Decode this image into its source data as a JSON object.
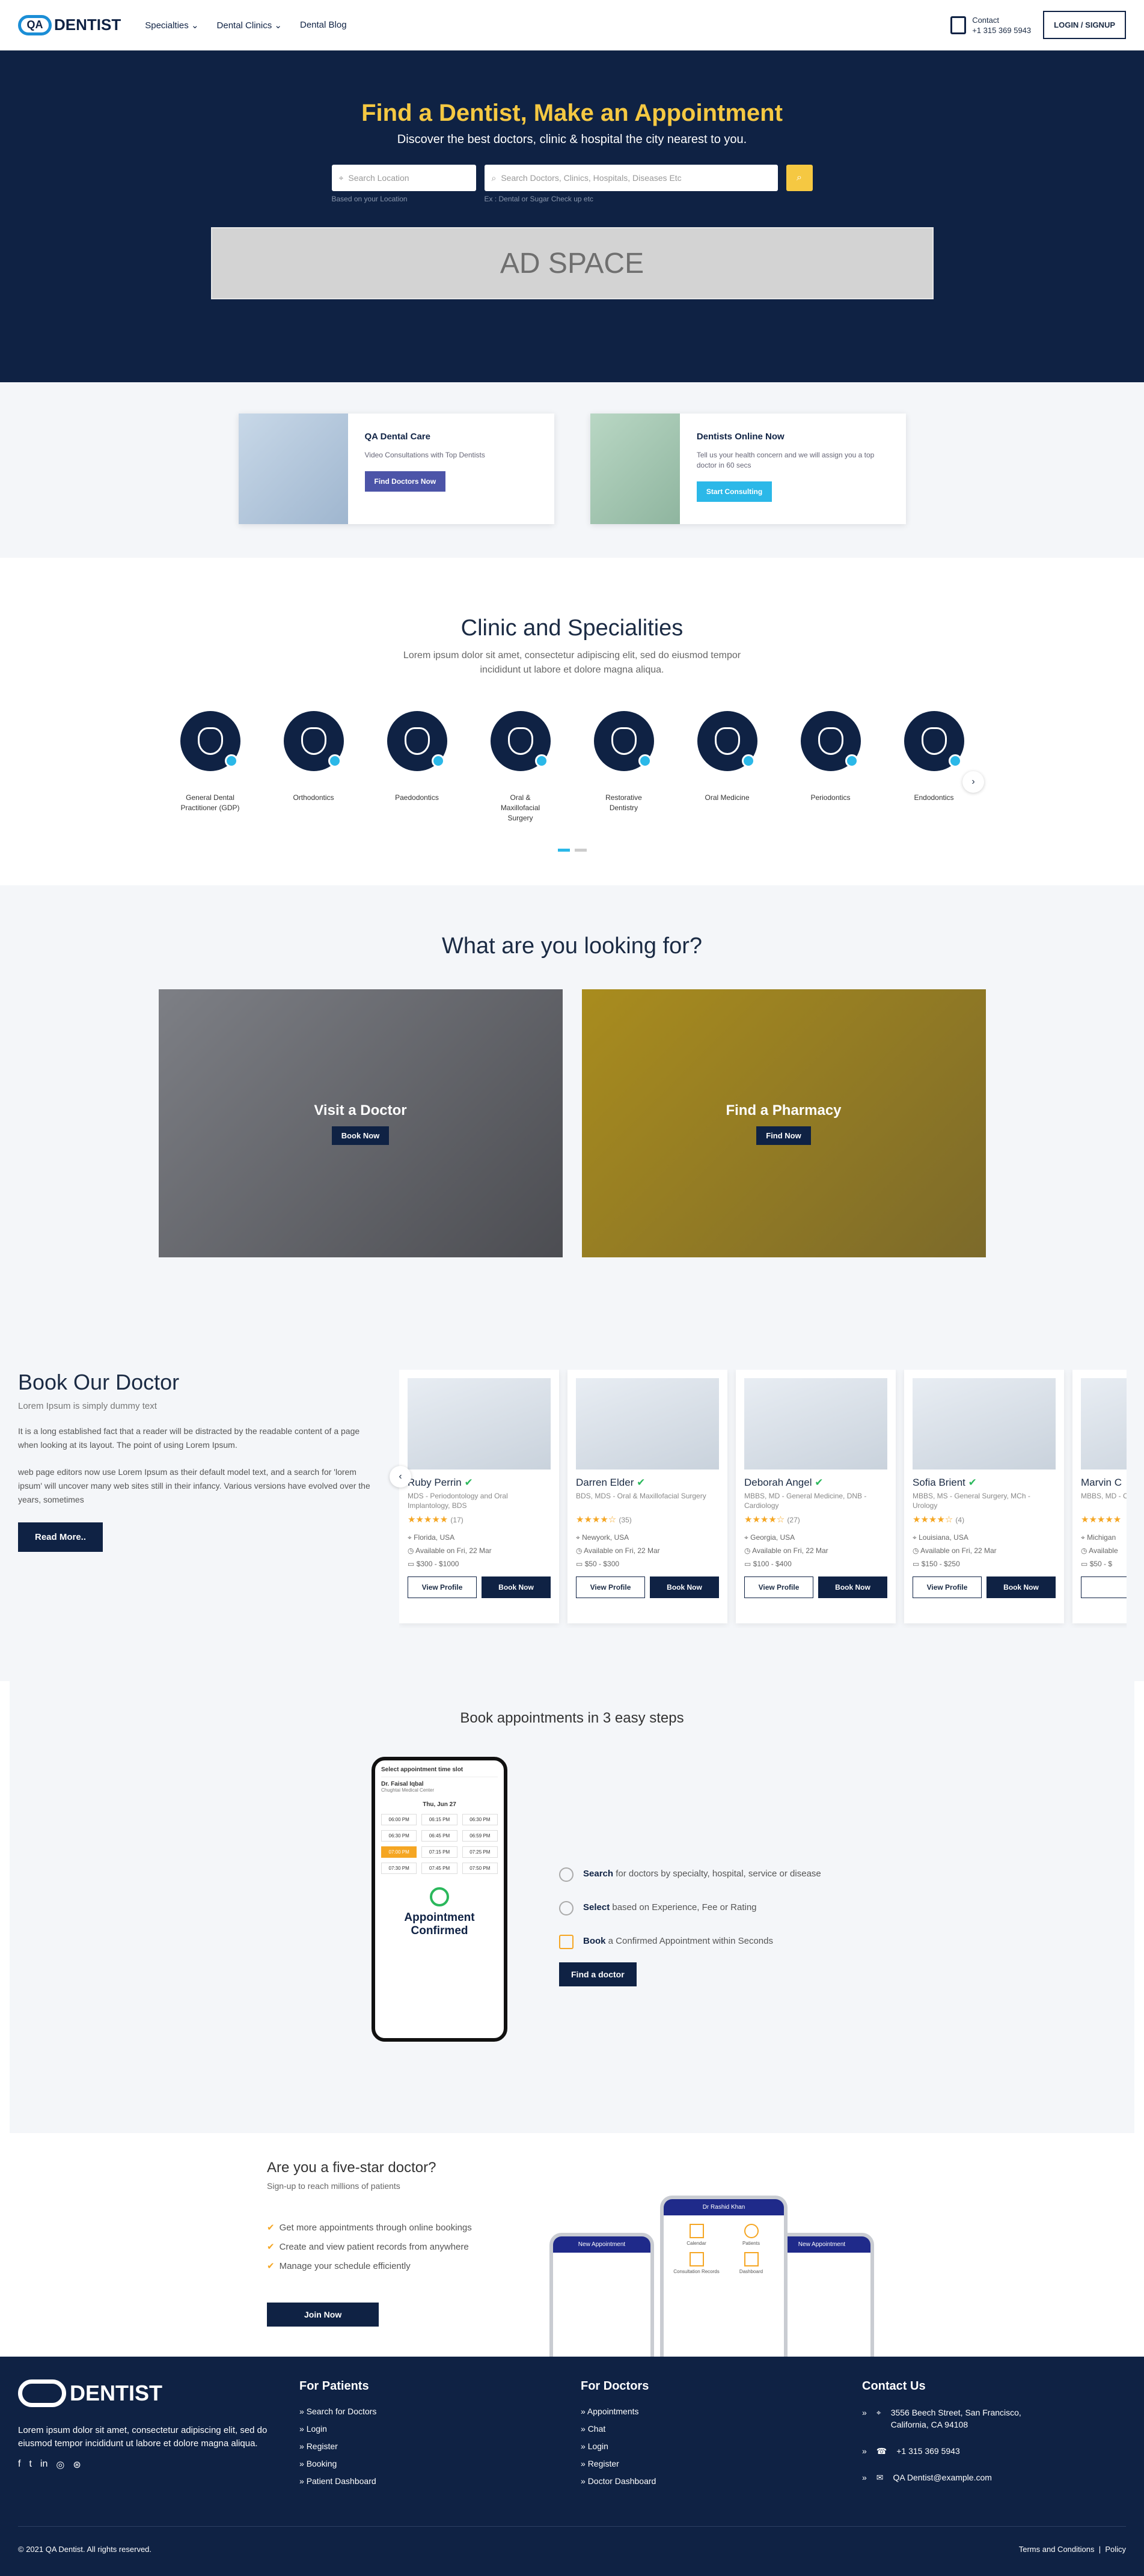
{
  "header": {
    "logo": "DENTIST",
    "logo_mark": "QA",
    "nav": [
      "Specialties",
      "Dental Clinics",
      "Dental Blog"
    ],
    "contact_label": "Contact",
    "contact_phone": "+1 315 369 5943",
    "login": "LOGIN / SIGNUP"
  },
  "hero": {
    "title": "Find a Dentist, Make an Appointment",
    "subtitle": "Discover the best doctors, clinic & hospital the city nearest to you.",
    "location_placeholder": "Search Location",
    "location_hint": "Based on your Location",
    "search_placeholder": "Search Doctors, Clinics, Hospitals, Diseases Etc",
    "search_hint": "Ex : Dental or Sugar Check up etc",
    "ad": "AD SPACE"
  },
  "promos": [
    {
      "title": "QA Dental Care",
      "text": "Video Consultations with Top Dentists",
      "button": "Find Doctors Now",
      "color": "#4c54a8"
    },
    {
      "title": "Dentists Online Now",
      "text": "Tell us your health concern and we will assign you a top doctor in 60 secs",
      "button": "Start Consulting",
      "color": "#2bb8e8"
    }
  ],
  "clinic": {
    "title": "Clinic and Specialities",
    "desc": "Lorem ipsum dolor sit amet, consectetur adipiscing elit, sed do eiusmod tempor incididunt ut labore et dolore magna aliqua.",
    "items": [
      "General Dental Practitioner (GDP)",
      "Orthodontics",
      "Paedodontics",
      "Oral & Maxillofacial Surgery",
      "Restorative Dentistry",
      "Oral Medicine",
      "Periodontics",
      "Endodontics"
    ]
  },
  "look": {
    "title": "What are you looking for?",
    "cards": [
      {
        "title": "Visit a Doctor",
        "button": "Book Now"
      },
      {
        "title": "Find a Pharmacy",
        "button": "Find Now"
      }
    ]
  },
  "book": {
    "title": "Book Our Doctor",
    "subtitle": "Lorem Ipsum is simply dummy text",
    "p1": "It is a long established fact that a reader will be distracted by the readable content of a page when looking at its layout. The point of using Lorem Ipsum.",
    "p2": "web page editors now use Lorem Ipsum as their default model text, and a search for 'lorem ipsum' will uncover many web sites still in their infancy. Various versions have evolved over the years, sometimes",
    "read_more": "Read More..",
    "doctors": [
      {
        "name": "Ruby Perrin",
        "deg": "MDS - Periodontology and Oral Implantology, BDS",
        "stars": "★★★★★",
        "reviews": "(17)",
        "loc": "Florida, USA",
        "avail": "Available on Fri, 22 Mar",
        "price": "$300 - $1000"
      },
      {
        "name": "Darren Elder",
        "deg": "BDS, MDS - Oral & Maxillofacial Surgery",
        "stars": "★★★★☆",
        "reviews": "(35)",
        "loc": "Newyork, USA",
        "avail": "Available on Fri, 22 Mar",
        "price": "$50 - $300"
      },
      {
        "name": "Deborah Angel",
        "deg": "MBBS, MD - General Medicine, DNB - Cardiology",
        "stars": "★★★★☆",
        "reviews": "(27)",
        "loc": "Georgia, USA",
        "avail": "Available on Fri, 22 Mar",
        "price": "$100 - $400"
      },
      {
        "name": "Sofia Brient",
        "deg": "MBBS, MS - General Surgery, MCh - Urology",
        "stars": "★★★★☆",
        "reviews": "(4)",
        "loc": "Louisiana, USA",
        "avail": "Available on Fri, 22 Mar",
        "price": "$150 - $250"
      },
      {
        "name": "Marvin C",
        "deg": "MBBS, MD - Ophthalmo",
        "stars": "★★★★★",
        "reviews": "",
        "loc": "Michigan",
        "avail": "Available",
        "price": "$50 - $"
      }
    ],
    "view_profile": "View Profile",
    "book_now": "Book Now"
  },
  "steps": {
    "title": "Book appointments in 3 easy steps",
    "phone_header": "Select appointment time slot",
    "phone_doctor": "Dr. Faisal Iqbal",
    "phone_clinic": "Chughtai Medical Center",
    "phone_date": "Thu, Jun 27",
    "slots": [
      "06:00 PM",
      "06:15 PM",
      "06:30 PM",
      "06:30 PM",
      "06:45 PM",
      "06:59 PM",
      "07:00 PM",
      "07:15 PM",
      "07:25 PM",
      "07:30 PM",
      "07:45 PM",
      "07:50 PM"
    ],
    "confirmed": "Appointment Confirmed",
    "items": [
      {
        "b": "Search",
        "t": "for doctors by specialty, hospital, service or disease"
      },
      {
        "b": "Select",
        "t": "based on Experience, Fee or Rating"
      },
      {
        "b": "Book",
        "t": "a Confirmed Appointment within Seconds"
      }
    ],
    "button": "Find a doctor"
  },
  "five": {
    "title": "Are you a five-star doctor?",
    "subtitle": "Sign-up to reach millions of patients",
    "items": [
      "Get more appointments through online bookings",
      "Create and view patient records from anywhere",
      "Manage your schedule efficiently"
    ],
    "button": "Join Now",
    "phone_titles": [
      "New Appointment",
      "Dr Rashid Khan",
      "New Appointment"
    ],
    "phone_tiles": [
      "Calendar",
      "Patients",
      "Consultation Records",
      "Dashboard"
    ]
  },
  "footer": {
    "desc": "Lorem ipsum dolor sit amet, consectetur adipiscing elit, sed do eiusmod tempor incididunt ut labore et dolore magna aliqua.",
    "patients_title": "For Patients",
    "patients": [
      "Search for Doctors",
      "Login",
      "Register",
      "Booking",
      "Patient Dashboard"
    ],
    "doctors_title": "For Doctors",
    "doctors": [
      "Appointments",
      "Chat",
      "Login",
      "Register",
      "Doctor Dashboard"
    ],
    "contact_title": "Contact Us",
    "address": "3556 Beech Street, San Francisco, California, CA 94108",
    "phone": "+1 315 369 5943",
    "email": "QA Dentist@example.com",
    "copyright": "© 2021 QA Dentist. All rights reserved.",
    "terms": "Terms and Conditions",
    "policy": "Policy"
  }
}
